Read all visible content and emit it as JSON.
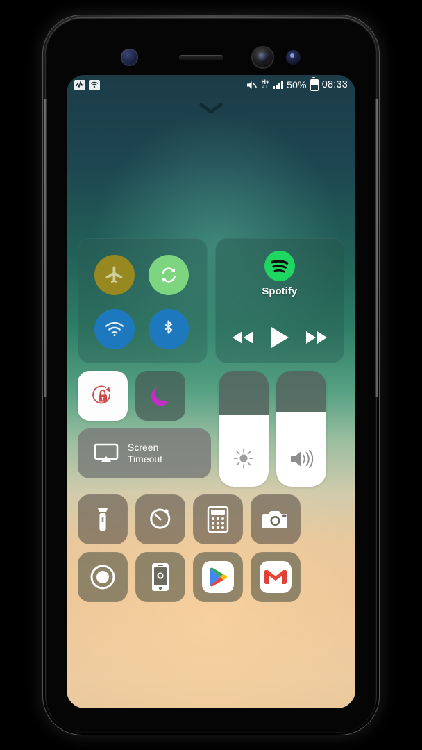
{
  "device": {
    "name": "samsung-galaxy-s8-mockup"
  },
  "status_bar": {
    "left_icons": [
      "activity-graph-icon",
      "wifi-notification-icon"
    ],
    "mute_icon": "mute-icon",
    "network_type": "H+",
    "network_sub": "4T",
    "signal_icon": "signal-bars-icon",
    "battery_percent": "50%",
    "battery_icon": "battery-icon",
    "clock": "08:33"
  },
  "grabber": {
    "icon": "chevron-down-icon"
  },
  "connectivity": {
    "toggles": [
      {
        "name": "airplane-mode",
        "icon": "airplane-icon",
        "state": "off",
        "color": "#988820"
      },
      {
        "name": "auto-rotate",
        "icon": "rotate-sync-icon",
        "state": "on",
        "color": "#7ed57f"
      },
      {
        "name": "wifi",
        "icon": "wifi-icon",
        "state": "on",
        "color": "#1e78be"
      },
      {
        "name": "bluetooth",
        "icon": "bluetooth-icon",
        "state": "on",
        "color": "#1e78be"
      }
    ]
  },
  "media": {
    "app_name": "Spotify",
    "app_icon": "spotify-icon",
    "brand_color": "#1ed760",
    "controls": [
      {
        "name": "previous-track",
        "icon": "rewind-icon"
      },
      {
        "name": "play",
        "icon": "play-icon"
      },
      {
        "name": "next-track",
        "icon": "fast-forward-icon"
      }
    ]
  },
  "quick_toggles": {
    "rotation_lock": {
      "label": "",
      "icon": "rotation-lock-icon",
      "state": "on",
      "color": "#d04a4a"
    },
    "do_not_disturb": {
      "label": "",
      "icon": "moon-icon",
      "state": "off",
      "color": "#c22fc2"
    },
    "screen_timeout": {
      "label": "Screen\nTimeout",
      "label_line1": "Screen",
      "label_line2": "Timeout",
      "icon": "screen-mirror-icon"
    }
  },
  "sliders": [
    {
      "name": "brightness-slider",
      "icon": "brightness-icon",
      "value": 62
    },
    {
      "name": "volume-slider",
      "icon": "volume-icon",
      "value": 64
    }
  ],
  "shortcuts_row1": [
    {
      "name": "flashlight",
      "icon": "flashlight-icon"
    },
    {
      "name": "timer",
      "icon": "timer-icon"
    },
    {
      "name": "calculator",
      "icon": "calculator-icon"
    },
    {
      "name": "camera",
      "icon": "camera-icon"
    }
  ],
  "shortcuts_row2": [
    {
      "name": "screen-record",
      "icon": "record-icon"
    },
    {
      "name": "screenshot",
      "icon": "screenshot-icon"
    },
    {
      "name": "play-store",
      "icon": "google-play-icon"
    },
    {
      "name": "gmail",
      "icon": "gmail-icon"
    }
  ]
}
